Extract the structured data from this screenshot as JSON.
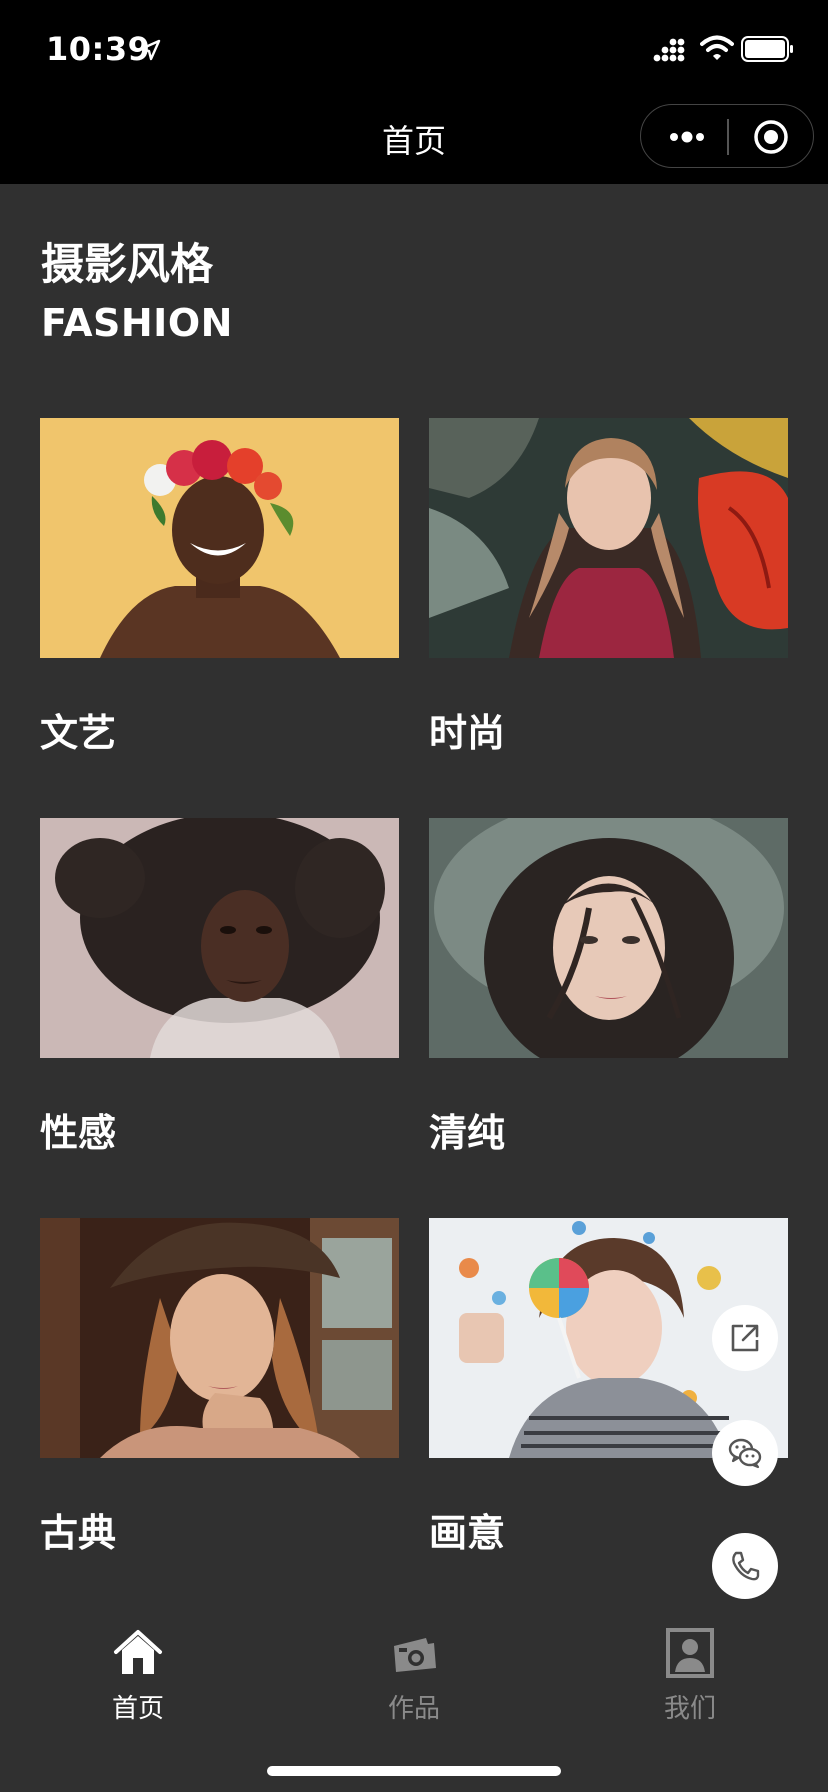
{
  "status_bar": {
    "time": "10:39"
  },
  "nav": {
    "title": "首页"
  },
  "section": {
    "title": "摄影风格",
    "subtitle": "FASHION"
  },
  "cards": [
    {
      "label": "文艺"
    },
    {
      "label": "时尚"
    },
    {
      "label": "性感"
    },
    {
      "label": "清纯"
    },
    {
      "label": "古典"
    },
    {
      "label": "画意"
    }
  ],
  "tabs": [
    {
      "label": "首页",
      "icon": "home-icon",
      "active": true
    },
    {
      "label": "作品",
      "icon": "camera-icon",
      "active": false
    },
    {
      "label": "我们",
      "icon": "profile-icon",
      "active": false
    }
  ],
  "floating_buttons": [
    "share-icon",
    "wechat-icon",
    "phone-icon"
  ],
  "colors": {
    "background": "#303030",
    "bar": "#000000",
    "active_tab": "#ffffff",
    "inactive_tab": "#8a8a8a"
  }
}
